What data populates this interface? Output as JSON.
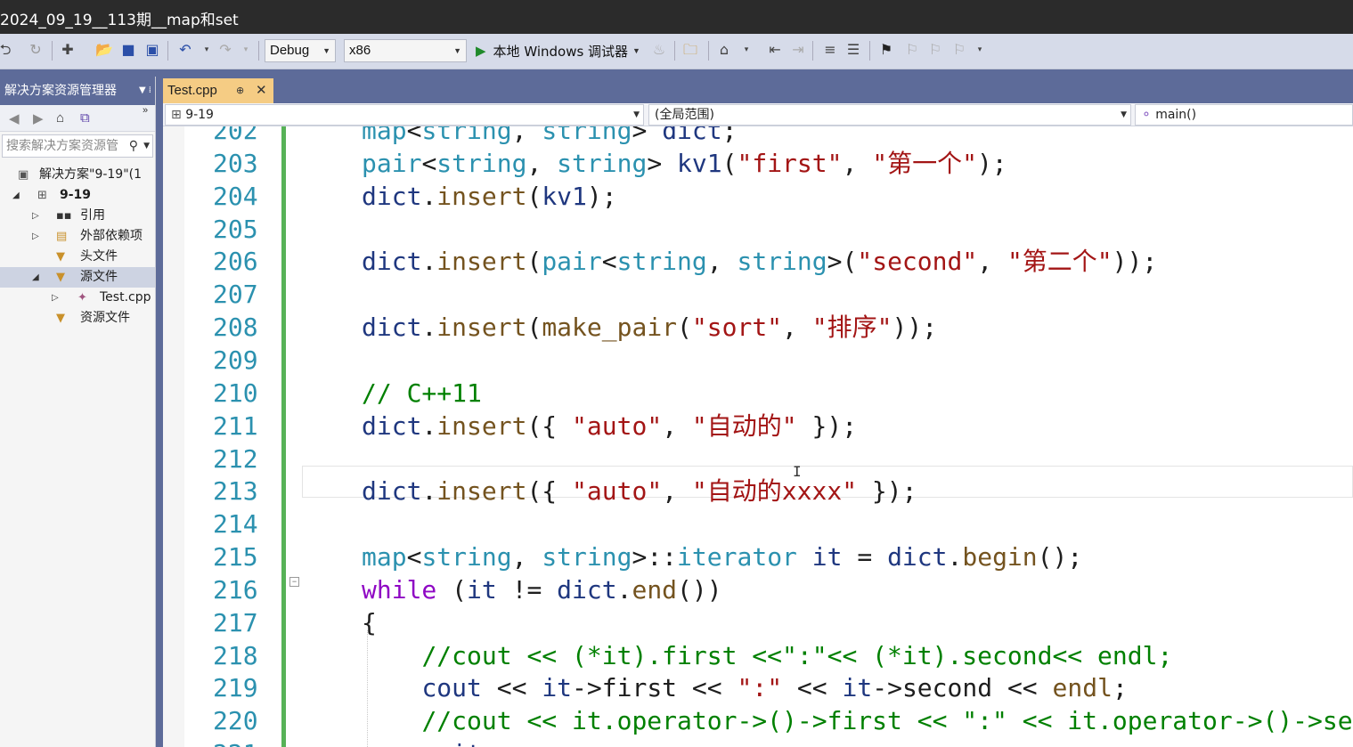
{
  "window": {
    "title": "2024_09_19__113期__map和set"
  },
  "toolbar": {
    "config": "Debug",
    "platform": "x86",
    "run_label": "本地 Windows 调试器"
  },
  "solution_explorer": {
    "title": "解决方案资源管理器",
    "search_placeholder": "搜索解决方案资源管",
    "items": [
      {
        "label": "解决方案\"9-19\"(1",
        "icon": "solution-icon"
      },
      {
        "label": "9-19",
        "icon": "project-icon"
      },
      {
        "label": "引用",
        "icon": "references-icon"
      },
      {
        "label": "外部依赖项",
        "icon": "external-deps-icon"
      },
      {
        "label": "头文件",
        "icon": "filter-folder-icon"
      },
      {
        "label": "源文件",
        "icon": "filter-folder-icon"
      },
      {
        "label": "Test.cpp",
        "icon": "cpp-file-icon"
      },
      {
        "label": "资源文件",
        "icon": "filter-folder-icon"
      }
    ]
  },
  "editor": {
    "tab_label": "Test.cpp",
    "nav_project": "9-19",
    "nav_scope": "(全局范围)",
    "nav_member": "main()",
    "lines": [
      {
        "n": "202",
        "code": "map<string, string> dict;"
      },
      {
        "n": "203",
        "code": "pair<string, string> kv1(\"first\", \"第一个\");"
      },
      {
        "n": "204",
        "code": "dict.insert(kv1);"
      },
      {
        "n": "205",
        "code": ""
      },
      {
        "n": "206",
        "code": "dict.insert(pair<string, string>(\"second\", \"第二个\"));"
      },
      {
        "n": "207",
        "code": ""
      },
      {
        "n": "208",
        "code": "dict.insert(make_pair(\"sort\", \"排序\"));"
      },
      {
        "n": "209",
        "code": ""
      },
      {
        "n": "210",
        "code": "// C++11"
      },
      {
        "n": "211",
        "code": "dict.insert({ \"auto\", \"自动的\" });"
      },
      {
        "n": "212",
        "code": ""
      },
      {
        "n": "213",
        "code": "dict.insert({ \"auto\", \"自动的xxxx\" });"
      },
      {
        "n": "214",
        "code": ""
      },
      {
        "n": "215",
        "code": "map<string, string>::iterator it = dict.begin();"
      },
      {
        "n": "216",
        "code": "while (it != dict.end())"
      },
      {
        "n": "217",
        "code": "{"
      },
      {
        "n": "218",
        "code": "    //cout << (*it).first <<\":\"<< (*it).second<< endl;"
      },
      {
        "n": "219",
        "code": "    cout << it->first << \":\" << it->second << endl;"
      },
      {
        "n": "220",
        "code": "    //cout << it.operator->()->first << \":\" << it.operator->()->sec"
      },
      {
        "n": "221",
        "code": "    ++it;"
      }
    ]
  },
  "colors": {
    "keyword": "#0000ff",
    "type": "#2b91af",
    "string": "#a31515",
    "comment": "#008000",
    "function": "#74531f",
    "variable": "#1f377f",
    "control": "#8f08c4",
    "tab_active": "#f5cc84",
    "chrome": "#5d6b99"
  }
}
